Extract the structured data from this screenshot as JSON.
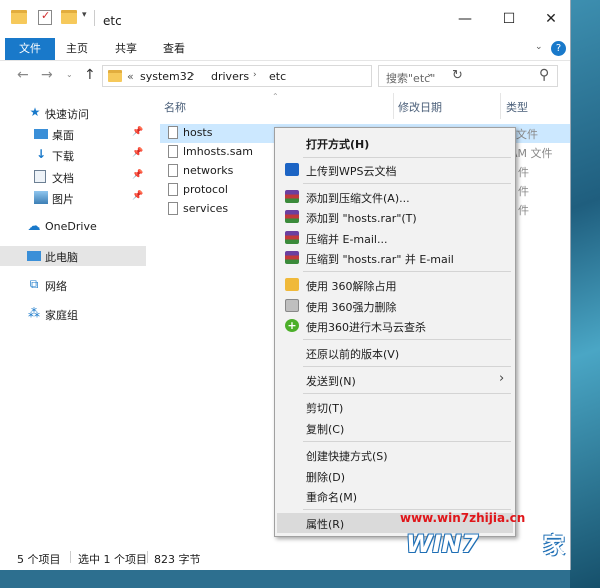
{
  "window": {
    "title": "etc",
    "minimize": "—",
    "maximize": "☐",
    "close": "✕"
  },
  "ribbon": {
    "tabs": [
      "文件",
      "主页",
      "共享",
      "查看"
    ],
    "help": "?"
  },
  "address": {
    "prefix": "«",
    "crumbs": [
      "system32",
      "drivers",
      "etc"
    ],
    "search_placeholder": "搜索\"etc\""
  },
  "navpane": {
    "items": [
      {
        "label": "快速访问",
        "icon": "star-icon"
      },
      {
        "label": "桌面",
        "icon": "desktop-icon",
        "pinned": true
      },
      {
        "label": "下载",
        "icon": "download-icon",
        "pinned": true
      },
      {
        "label": "文档",
        "icon": "documents-icon",
        "pinned": true
      },
      {
        "label": "图片",
        "icon": "pictures-icon",
        "pinned": true
      },
      {
        "label": "OneDrive",
        "icon": "cloud-icon"
      },
      {
        "label": "此电脑",
        "icon": "computer-icon",
        "selected": true
      },
      {
        "label": "网络",
        "icon": "network-icon"
      },
      {
        "label": "家庭组",
        "icon": "homegroup-icon"
      }
    ]
  },
  "columns": {
    "name": "名称",
    "modified": "修改日期",
    "type": "类型"
  },
  "files": [
    {
      "name": "hosts",
      "type": "文件",
      "selected": true
    },
    {
      "name": "lmhosts.sam",
      "type": "AM 文件"
    },
    {
      "name": "networks",
      "type": "件"
    },
    {
      "name": "protocol",
      "type": "件"
    },
    {
      "name": "services",
      "type": "件"
    }
  ],
  "context_menu": {
    "open_with": "打开方式(H)",
    "upload_wps": "上传到WPS云文档",
    "add_archive": "添加到压缩文件(A)...",
    "add_to_rar": "添加到 \"hosts.rar\"(T)",
    "compress_email": "压缩并 E-mail...",
    "compress_rar_email": "压缩到 \"hosts.rar\" 并 E-mail",
    "unlock_360": "使用 360解除占用",
    "force_delete_360": "使用 360强力删除",
    "scan_360": "使用360进行木马云查杀",
    "restore_prev": "还原以前的版本(V)",
    "send_to": "发送到(N)",
    "cut": "剪切(T)",
    "copy": "复制(C)",
    "create_shortcut": "创建快捷方式(S)",
    "delete": "删除(D)",
    "rename": "重命名(M)",
    "properties": "属性(R)"
  },
  "status": {
    "item_count": "5 个项目",
    "selected": "选中 1 个项目",
    "size": "823 字节"
  },
  "watermark": {
    "url": "www.win7zhijia.cn",
    "logo": "WIN7",
    "home": "家"
  },
  "colors": {
    "accent": "#1979ca",
    "selection": "#cce8ff",
    "menu_bg": "#f2f2f2",
    "watermark_red": "#e0161a"
  }
}
